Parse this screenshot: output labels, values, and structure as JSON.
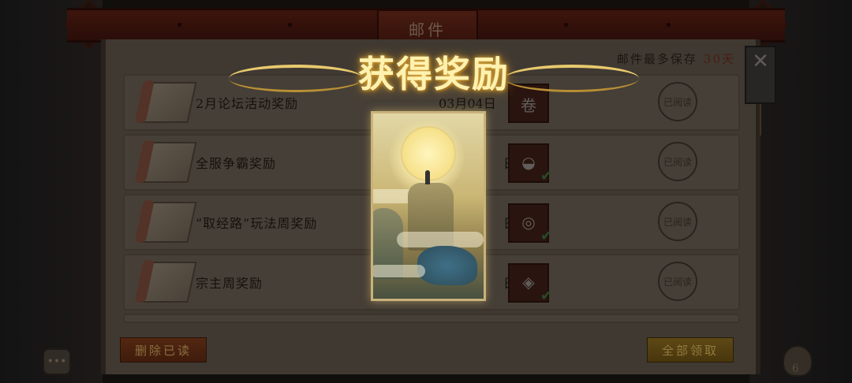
{
  "window": {
    "title": "邮件"
  },
  "mail_limit": {
    "label": "邮件最多保存",
    "value": "30天"
  },
  "mails": [
    {
      "title": "2月论坛活动奖励",
      "date": "03月04日",
      "item_icon": "scroll-item-icon",
      "status": "已阅读"
    },
    {
      "title": "全服争霸奖励",
      "date": "日",
      "item_icon": "silver-ingot-icon",
      "status": "已阅读"
    },
    {
      "title": "“取经路”玩法周奖励",
      "date": "日",
      "item_icon": "coin-icon",
      "status": "已阅读"
    },
    {
      "title": "宗主周奖励",
      "date": "日",
      "item_icon": "silver-pieces-icon",
      "status": "已阅读"
    }
  ],
  "buttons": {
    "delete_read": "删除已读",
    "claim_all": "全部领取"
  },
  "reward_popup": {
    "title": "获得奖励"
  },
  "bag": {
    "count": "6"
  },
  "icons": {
    "close": "close-icon",
    "chat": "chat-icon",
    "bag": "bag-icon"
  },
  "colors": {
    "frame_red": "#5a1f14",
    "parchment": "#5e554b",
    "gold": "#e8c96d"
  }
}
